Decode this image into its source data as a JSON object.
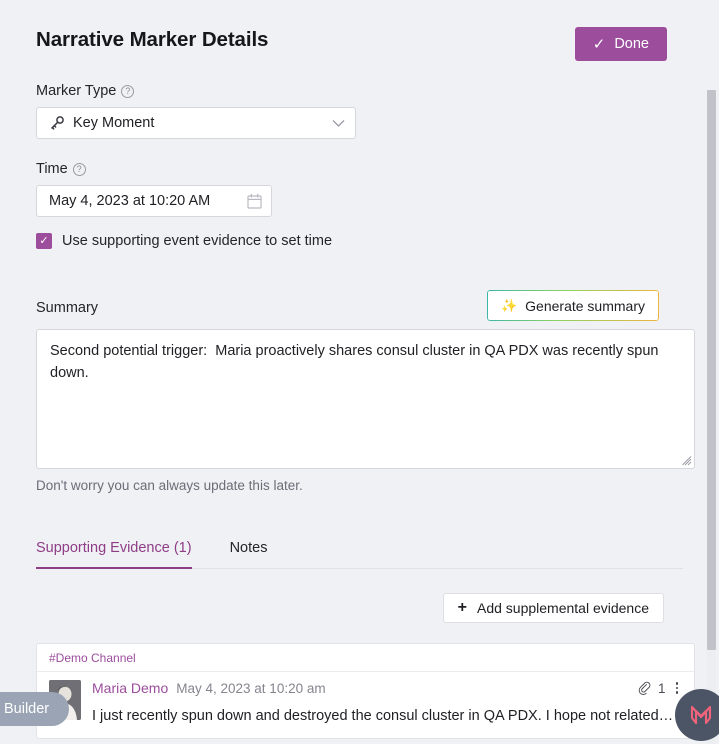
{
  "header": {
    "title": "Narrative Marker Details",
    "done_label": "Done",
    "done_icon": "check-icon",
    "done_color": "#9c4d9c"
  },
  "marker_type": {
    "label": "Marker Type",
    "help_icon": "question-mark-icon",
    "help_glyph": "?",
    "selected": "Key Moment",
    "value_icon": "key-icon",
    "chevron_icon": "chevron-down-icon",
    "chevron_glyph": "⌄"
  },
  "time": {
    "label": "Time",
    "help_icon": "question-mark-icon",
    "help_glyph": "?",
    "value": "May 4, 2023 at 10:20 AM",
    "calendar_icon": "calendar-icon",
    "checkbox_checked": true,
    "checkbox_glyph": "✓",
    "checkbox_label": "Use supporting event evidence to set time"
  },
  "summary": {
    "label": "Summary",
    "generate_label": "Generate summary",
    "generate_icon": "sparkles-icon",
    "generate_glyph": "✨",
    "text": "Second potential trigger:  Maria proactively shares consul cluster in QA PDX was recently spun down.",
    "helper": "Don't worry you can always update this later.",
    "gradient_start": "#39b6a8",
    "gradient_end": "#f2b23f"
  },
  "tabs": {
    "items": [
      {
        "label": "Supporting Evidence (1)",
        "active": true
      },
      {
        "label": "Notes",
        "active": false
      }
    ],
    "active_color": "#8e3d86"
  },
  "evidence": {
    "add_label": "Add supplemental evidence",
    "add_icon": "plus-icon",
    "add_glyph": "+",
    "card": {
      "channel": "#Demo Channel",
      "author": "Maria Demo",
      "timestamp": "May 4, 2023 at 10:20 am",
      "attachment_icon": "paperclip-icon",
      "attachment_count": "1",
      "menu_icon": "kebab-menu-icon",
      "avatar_icon": "user-avatar",
      "message": "I  just recently spun down and destroyed the consul cluster in QA PDX. I hope not related…"
    }
  },
  "widgets": {
    "builder_label": "Builder",
    "brand_icon": "brand-logo-icon"
  }
}
